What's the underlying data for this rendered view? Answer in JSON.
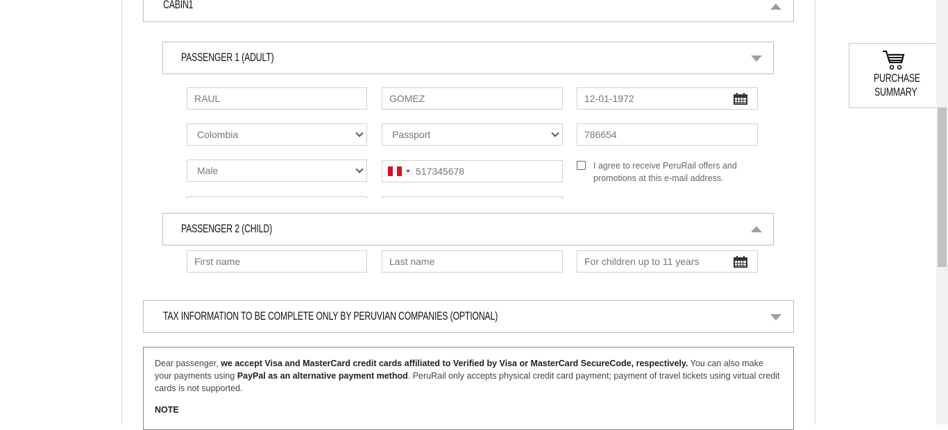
{
  "cabin": {
    "title": "CABIN1"
  },
  "passenger1": {
    "title": "PASSENGER 1 (ADULT)",
    "first_name": "RAUL",
    "last_name": "GOMEZ",
    "birth_date": "12-01-1972",
    "nationality": "Colombia",
    "document_type": "Passport",
    "document_number": "786654",
    "gender": "Male",
    "phone": "517345678",
    "offers_label": "I agree to receive PeruRail offers and promotions at this e-mail address."
  },
  "passenger2": {
    "title": "PASSENGER 2 (CHILD)",
    "first_name_placeholder": "First name",
    "last_name_placeholder": "Last name",
    "birth_date_placeholder": "For children up to 11 years"
  },
  "tax": {
    "title": "TAX INFORMATION TO BE COMPLETE ONLY BY PERUVIAN COMPANIES (OPTIONAL)"
  },
  "notice": {
    "p1_a": "Dear passenger, ",
    "p1_b": "we accept Visa and MasterCard credit cards affiliated to Verified by Visa or MasterCard SecureCode, respectively.",
    "p1_c": " You can also make your payments using ",
    "p1_d": "PayPal as an alternative payment method",
    "p1_e": ". PeruRail only accepts physical credit card payment; payment of travel tickets using virtual credit cards is not supported.",
    "note_label": "NOTE"
  },
  "summary": {
    "line1": "PURCHASE",
    "line2": "SUMMARY"
  },
  "colors": {
    "flag_red": "#d91023"
  }
}
